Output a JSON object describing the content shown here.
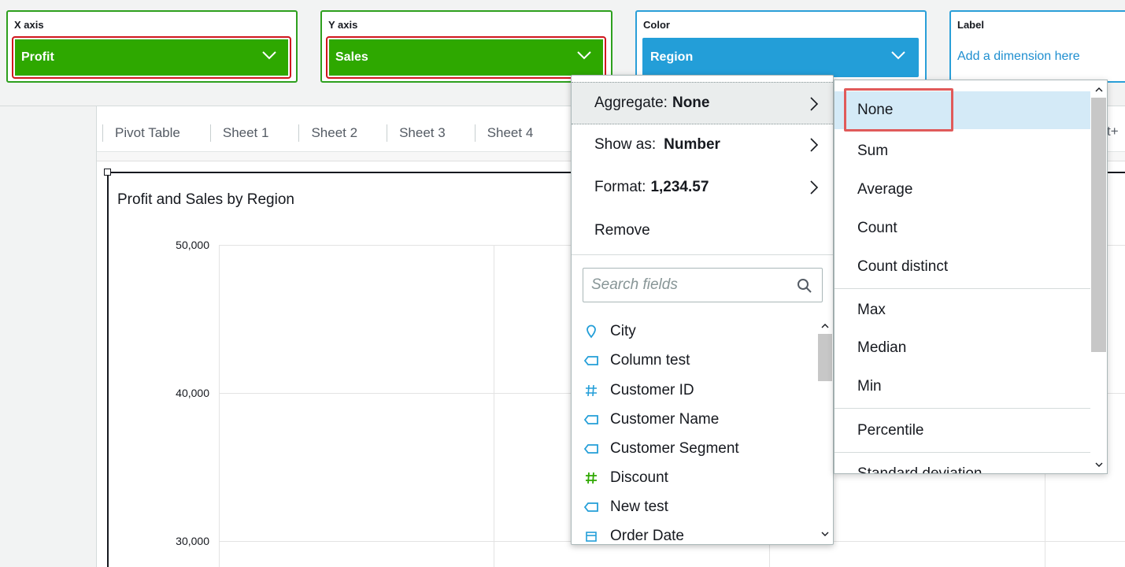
{
  "field_wells": {
    "x_axis": {
      "title": "X axis",
      "value": "Profit"
    },
    "y_axis": {
      "title": "Y axis",
      "value": "Sales"
    },
    "color": {
      "title": "Color",
      "value": "Region"
    },
    "label": {
      "title": "Label",
      "placeholder": "Add a dimension here"
    }
  },
  "tabs": [
    "Pivot Table",
    "Sheet 1",
    "Sheet 2",
    "Sheet 3",
    "Sheet 4"
  ],
  "tab_overflow_text": "t+",
  "visual": {
    "title": "Profit and Sales by Region",
    "y_ticks": [
      "50,000",
      "40,000",
      "30,000"
    ]
  },
  "field_menu": {
    "aggregate": {
      "label": "Aggregate:",
      "value": "None"
    },
    "show_as": {
      "label": "Show as:",
      "value": "Number"
    },
    "format": {
      "label": "Format:",
      "value": "1,234.57"
    },
    "remove": "Remove",
    "search_placeholder": "Search fields",
    "fields": [
      {
        "name": "City",
        "icon": "map-pin-icon"
      },
      {
        "name": "Column test",
        "icon": "tag-icon"
      },
      {
        "name": "Customer ID",
        "icon": "hash-icon-blue"
      },
      {
        "name": "Customer Name",
        "icon": "tag-icon"
      },
      {
        "name": "Customer Segment",
        "icon": "tag-icon"
      },
      {
        "name": "Discount",
        "icon": "hash-icon-green"
      },
      {
        "name": "New test",
        "icon": "tag-icon"
      },
      {
        "name": "Order Date",
        "icon": "calendar-icon"
      }
    ]
  },
  "aggregate_submenu": {
    "items": [
      "None",
      "Sum",
      "Average",
      "Count",
      "Count distinct",
      "Max",
      "Median",
      "Min",
      "Percentile",
      "Standard deviation"
    ],
    "selected": "None"
  },
  "colors": {
    "green_well": "#2ea800",
    "blue_well": "#239ed8",
    "highlight_red": "#d0161e",
    "selected_bg": "#d4eaf7"
  }
}
